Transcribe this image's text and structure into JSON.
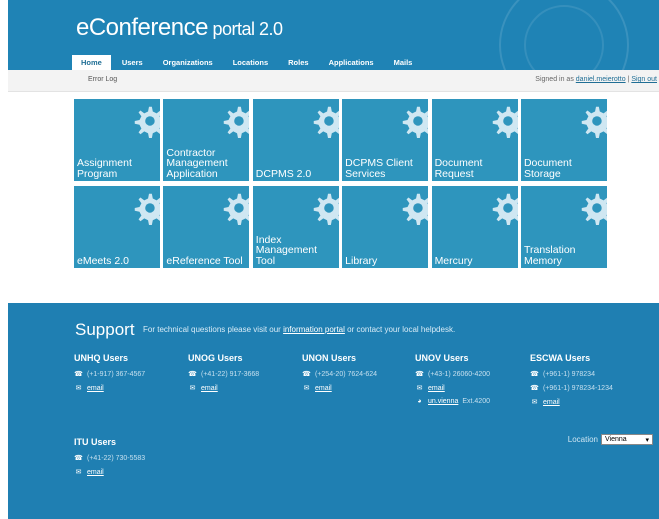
{
  "header": {
    "logo_main": "eConference",
    "logo_sub": " portal 2.0"
  },
  "nav": {
    "tabs": [
      {
        "label": "Home",
        "active": true
      },
      {
        "label": "Users",
        "active": false
      },
      {
        "label": "Organizations",
        "active": false
      },
      {
        "label": "Locations",
        "active": false
      },
      {
        "label": "Roles",
        "active": false
      },
      {
        "label": "Applications",
        "active": false
      },
      {
        "label": "Mails",
        "active": false
      }
    ]
  },
  "subbar": {
    "error_log": "Error Log",
    "signed_in_prefix": "Signed in as ",
    "username": "daniel.meierotto",
    "separator": " | ",
    "sign_out": "Sign out"
  },
  "tiles": [
    "Assignment Program",
    "Contractor Management Application",
    "DCPMS 2.0",
    "DCPMS Client Services",
    "Document Request",
    "Document Storage",
    "eMeets 2.0",
    "eReference Tool",
    "Index Management Tool",
    "Library",
    "Mercury",
    "Translation Memory"
  ],
  "support": {
    "title": "Support",
    "text_before": "For technical questions please visit our ",
    "link": "information portal",
    "text_after": " or contact your local helpdesk.",
    "columns": [
      {
        "title": "UNHQ Users",
        "phone": "(+1-917) 367-4567",
        "email": "email"
      },
      {
        "title": "UNOG Users",
        "phone": "(+41-22) 917-3668",
        "email": "email"
      },
      {
        "title": "UNON Users",
        "phone": "(+254-20) 7624-624",
        "email": "email"
      },
      {
        "title": "UNOV Users",
        "phone": "(+43-1) 26060-4200",
        "email": "email",
        "skype": "un.vienna",
        "ext": "Ext.4200"
      },
      {
        "title": "ESCWA Users",
        "phone": "(+961-1) 978234",
        "phone2": "(+961-1) 978234-1234",
        "email": "email"
      },
      {
        "title": "ITU Users",
        "phone": "(+41-22) 730-5583",
        "email": "email"
      }
    ],
    "location_label": "Location",
    "location_value": "Vienna"
  },
  "colors": {
    "header_blue": "#1f83b5",
    "tile_blue": "#2e95bd",
    "footer_blue": "#1f7fb2"
  }
}
